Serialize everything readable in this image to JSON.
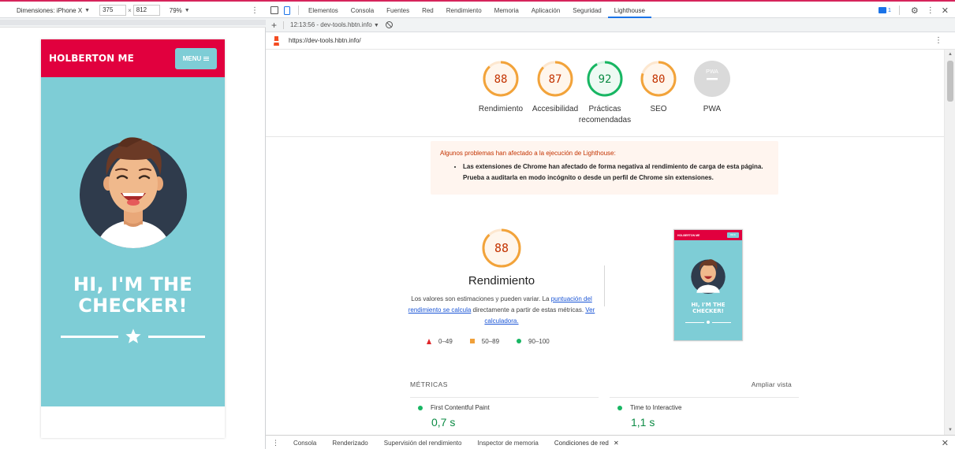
{
  "device_toolbar": {
    "device_label": "Dimensiones: iPhone X",
    "width": "375",
    "height": "812",
    "zoom": "79%"
  },
  "phone": {
    "brand": "HOLBERTON ME",
    "menu_label": "MENU",
    "hero_title_line1": "HI, I'M THE",
    "hero_title_line2": "CHECKER!"
  },
  "devtools": {
    "tabs": [
      {
        "label": "Elementos"
      },
      {
        "label": "Consola"
      },
      {
        "label": "Fuentes"
      },
      {
        "label": "Red"
      },
      {
        "label": "Rendimiento"
      },
      {
        "label": "Memoria"
      },
      {
        "label": "Aplicación"
      },
      {
        "label": "Seguridad"
      },
      {
        "label": "Lighthouse"
      }
    ],
    "active_tab": "Lighthouse",
    "badge_count": "1"
  },
  "lighthouse": {
    "report_select": "12:13:56 - dev-tools.hbtn.info",
    "url": "https://dev-tools.hbtn.info/",
    "gauges": [
      {
        "label": "Rendimiento",
        "score": "88",
        "value": 88,
        "color": "#f2a33a",
        "text_color": "#c33300"
      },
      {
        "label": "Accesibilidad",
        "score": "87",
        "value": 87,
        "color": "#f2a33a",
        "text_color": "#c33300"
      },
      {
        "label": "Prácticas recomendadas",
        "score": "92",
        "value": 92,
        "color": "#18b663",
        "text_color": "#0c8b45"
      },
      {
        "label": "SEO",
        "score": "80",
        "value": 80,
        "color": "#f2a33a",
        "text_color": "#c33300"
      },
      {
        "label": "PWA",
        "score": "PWA",
        "value": 0,
        "color": "#cccccc",
        "text_color": "#ffffff"
      }
    ],
    "warning": {
      "title": "Algunos problemas han afectado a la ejecución de Lighthouse:",
      "item": "Las extensiones de Chrome han afectado de forma negativa al rendimiento de carga de esta página. Prueba a auditarla en modo incógnito o desde un perfil de Chrome sin extensiones."
    },
    "performance": {
      "score": "88",
      "title": "Rendimiento",
      "desc_1": "Los valores son estimaciones y pueden variar. La ",
      "desc_link1": "puntuación del rendimiento se calcula",
      "desc_2": " directamente a partir de estas métricas. ",
      "desc_link2": "Ver calculadora."
    },
    "legend": {
      "fail": "0–49",
      "average": "50–89",
      "pass": "90–100"
    },
    "thumbnail": {
      "brand": "HOLBERTON ME",
      "menu": "MENU",
      "title_line1": "HI, I'M THE",
      "title_line2": "CHECKER!"
    },
    "metrics": {
      "header": "MÉTRICAS",
      "expand": "Ampliar vista",
      "items": [
        {
          "name": "First Contentful Paint",
          "value": "0,7 s"
        },
        {
          "name": "Time to Interactive",
          "value": "1,1 s"
        }
      ]
    }
  },
  "drawer": {
    "tabs": [
      {
        "label": "Consola"
      },
      {
        "label": "Renderizado"
      },
      {
        "label": "Supervisión del rendimiento"
      },
      {
        "label": "Inspector de memoria"
      },
      {
        "label": "Condiciones de red"
      }
    ]
  }
}
